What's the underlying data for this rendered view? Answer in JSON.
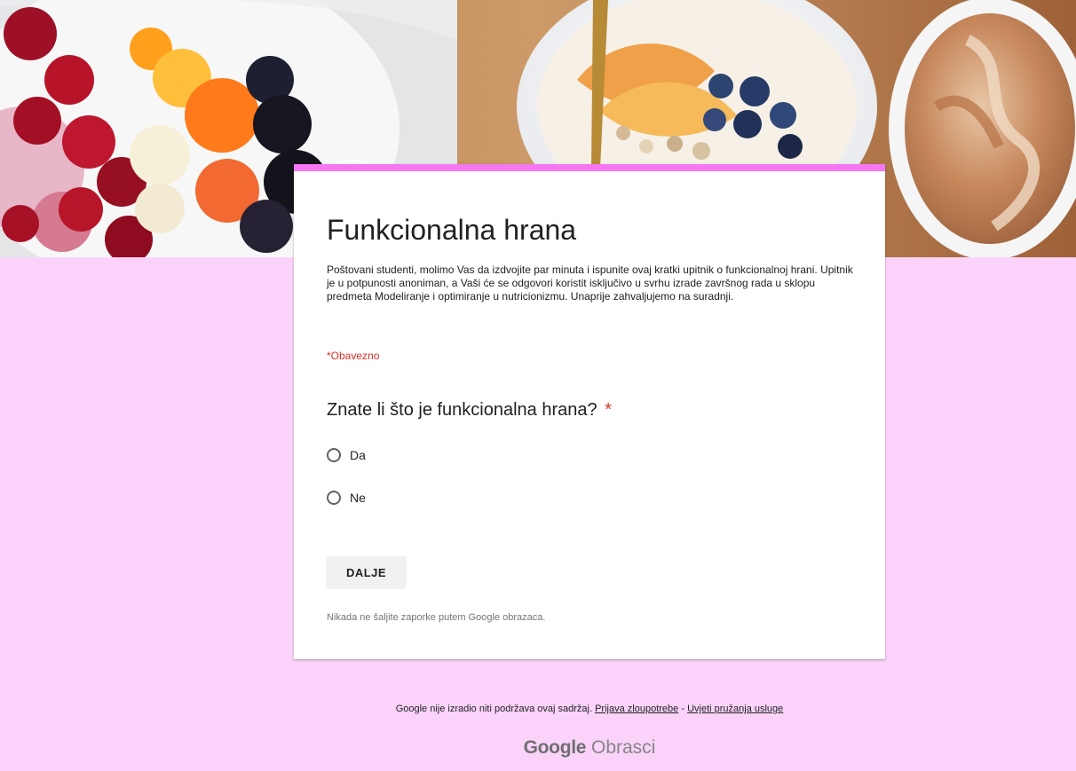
{
  "form": {
    "title": "Funkcionalna hrana",
    "description": "Poštovani studenti, molimo Vas da izdvojite par minuta i ispunite ovaj kratki upitnik o funkcionalnoj hrani. Upitnik je u potpunosti anoniman, a Vaši će se odgovori koristit isključivo u svrhu izrade završnog rada u sklopu predmeta Modeliranje i optimiranje u nutricionizmu. Unaprije zahvaljujemo na suradnji.",
    "required_note": "*Obavezno",
    "question": {
      "title": "Znate li što je funkcionalna hrana?",
      "required_marker": "*",
      "options": [
        {
          "label": "Da",
          "selected": false
        },
        {
          "label": "Ne",
          "selected": false
        }
      ]
    },
    "next_button": "DALJE",
    "password_warning": "Nikada ne šaljite zaporke putem Google obrazaca."
  },
  "footer": {
    "notice_prefix": "Google nije izradio niti podržava ovaj sadržaj.",
    "abuse_link": "Prijava zloupotrebe",
    "separator": "-",
    "terms_link": "Uvjeti pružanja usluge",
    "brand_google": "Google",
    "brand_forms": "Obrasci"
  },
  "colors": {
    "page_background": "#fbd3fa",
    "accent": "#f578f2",
    "required": "#d93025"
  },
  "icons": {
    "radio_unchecked": "radio-unchecked-icon"
  }
}
